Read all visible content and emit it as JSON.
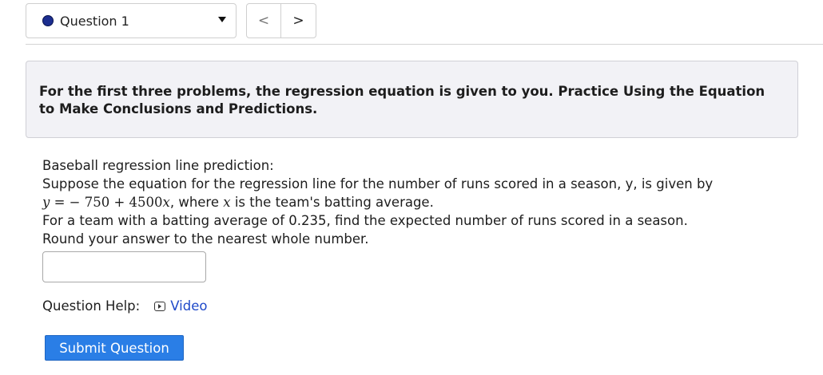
{
  "question_selector": {
    "label": "Question 1",
    "dot_color": "#1c2e8f"
  },
  "nav": {
    "prev_label": "<",
    "next_label": ">"
  },
  "intro_text": "For the first three problems, the regression equation is given to you. Practice Using the Equation to Make Conclusions and Predictions.",
  "problem": {
    "title": "Baseball regression line prediction:",
    "line1": "Suppose the equation for the regression line for the number of runs scored in a season, y, is given by",
    "equation_lhs": "y",
    "equation_eq": " = ",
    "equation_rhs_num": " − 750 + 4500",
    "equation_rhs_var": "x",
    "equation_tail": ", where ",
    "var_x": "x",
    "equation_tail2": " is the team's batting average.",
    "line3": "For a team with a batting average of 0.235, find the expected number of runs scored in a season.",
    "line4": "Round your answer to the nearest whole number."
  },
  "answer": {
    "value": ""
  },
  "help": {
    "label": "Question Help:",
    "video_label": "Video",
    "link_color": "#1f49c9"
  },
  "submit_label": "Submit Question",
  "accent_color": "#2a7ee6"
}
